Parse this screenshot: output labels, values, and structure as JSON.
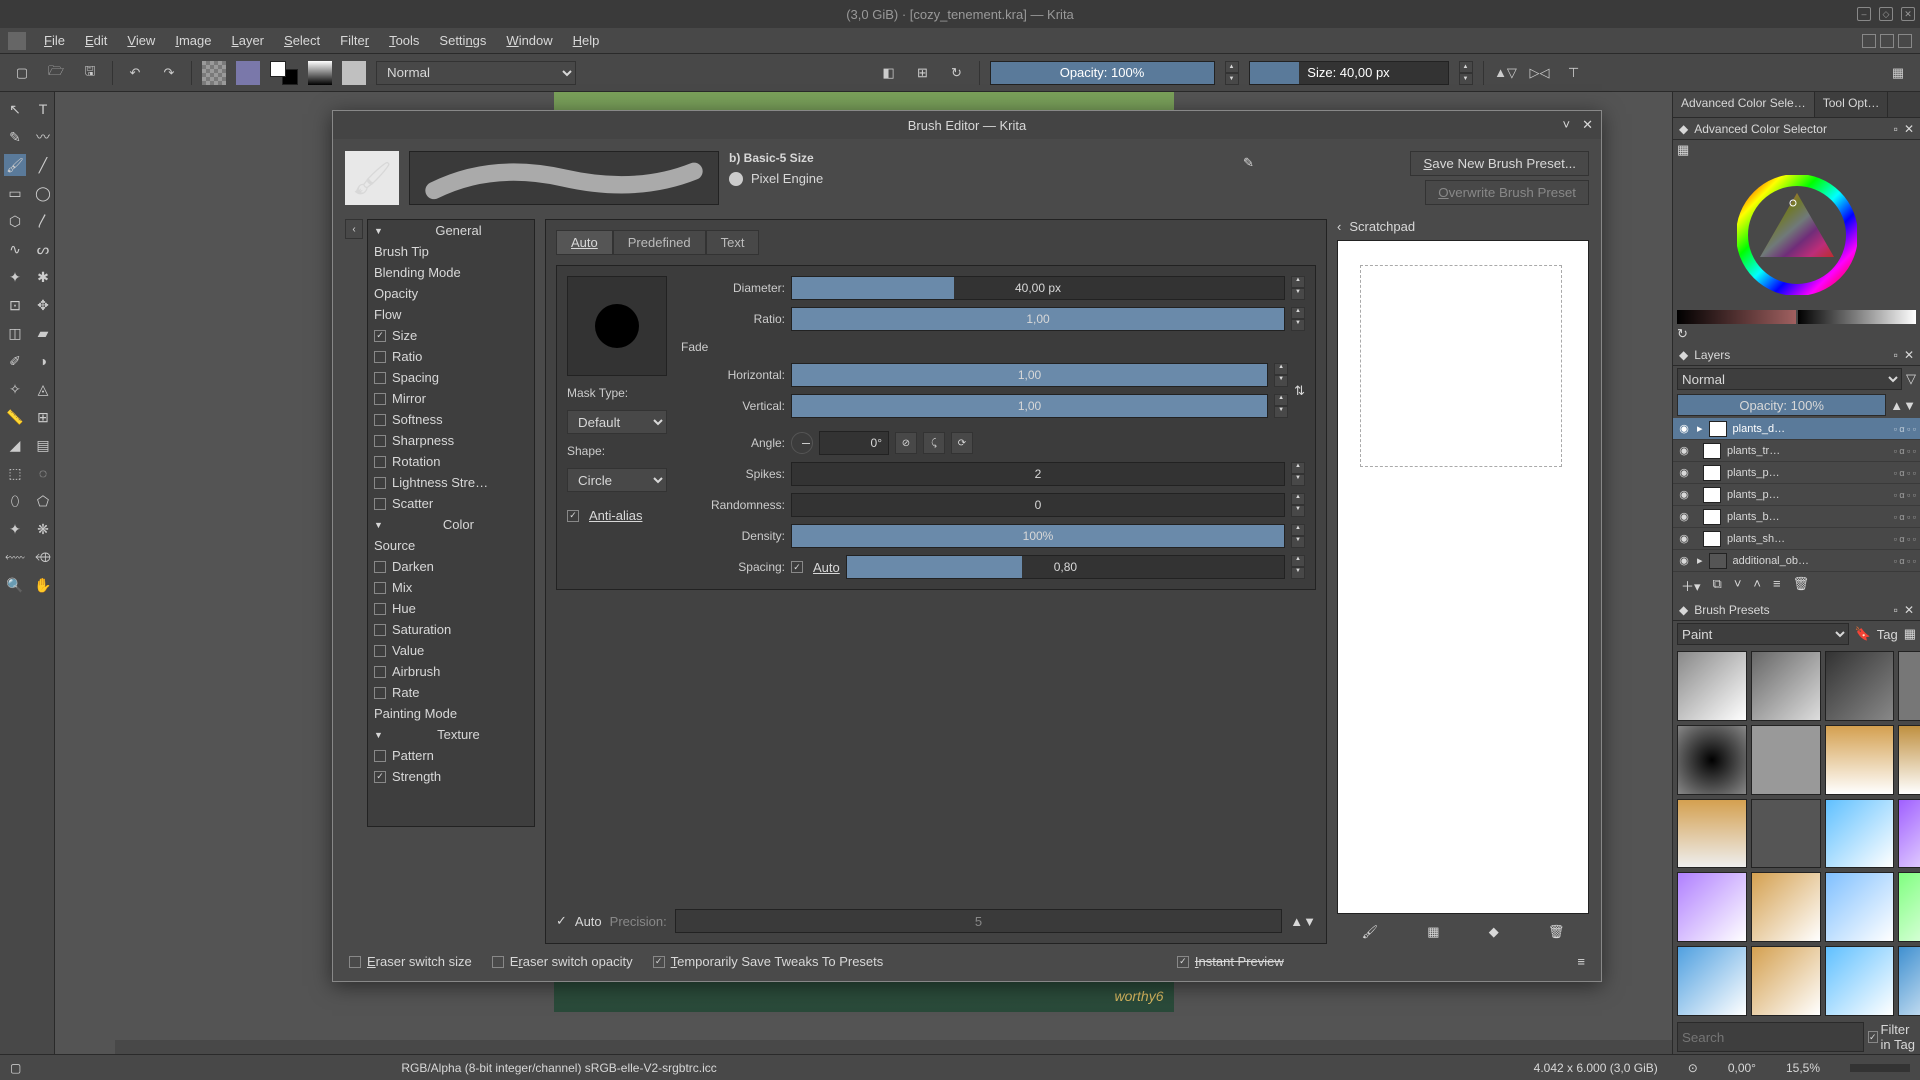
{
  "window": {
    "title": "(3,0 GiB) · [cozy_tenement.kra] — Krita"
  },
  "menubar": [
    "File",
    "Edit",
    "View",
    "Image",
    "Layer",
    "Select",
    "Filter",
    "Tools",
    "Settings",
    "Window",
    "Help"
  ],
  "toolbar": {
    "blendmode": "Normal",
    "opacity_label": "Opacity: 100%",
    "opacity_fill_pct": 100,
    "size_label": "Size: 40,00 px",
    "size_fill_pct": 25
  },
  "right_panels": {
    "tab1": "Advanced Color Sele…",
    "tab2": "Tool Opt…",
    "acs_title": "Advanced Color Selector",
    "layers_title": "Layers",
    "layers_blendmode": "Normal",
    "layers_opacity": "Opacity:  100%",
    "layers": [
      {
        "name": "plants_d…",
        "sel": true
      },
      {
        "name": "plants_tr…",
        "sel": false
      },
      {
        "name": "plants_p…",
        "sel": false
      },
      {
        "name": "plants_p…",
        "sel": false
      },
      {
        "name": "plants_b…",
        "sel": false
      },
      {
        "name": "plants_sh…",
        "sel": false
      },
      {
        "name": "additional_ob…",
        "sel": false
      }
    ],
    "presets_title": "Brush Presets",
    "presets_tag": "Paint",
    "tag_label": "Tag",
    "search_placeholder": "Search",
    "filter_in_tag": "Filter in Tag"
  },
  "statusbar": {
    "profile": "RGB/Alpha (8-bit integer/channel)  sRGB-elle-V2-srgbtrc.icc",
    "dims": "4.042 x 6.000 (3,0 GiB)",
    "rotation": "0,00°",
    "zoom": "15,5%"
  },
  "dialog": {
    "title": "Brush Editor — Krita",
    "preset_name": "b) Basic-5 Size",
    "engine": "Pixel Engine",
    "save_new": "Save New Brush Preset...",
    "overwrite": "Overwrite Brush Preset",
    "tree": {
      "groups": [
        {
          "title": "General",
          "items": [
            {
              "label": "Brush Tip",
              "cb": null
            },
            {
              "label": "Blending Mode",
              "cb": null
            },
            {
              "label": "Opacity",
              "cb": null
            },
            {
              "label": "Flow",
              "cb": null
            },
            {
              "label": "Size",
              "cb": true
            },
            {
              "label": "Ratio",
              "cb": false
            },
            {
              "label": "Spacing",
              "cb": false
            },
            {
              "label": "Mirror",
              "cb": false
            },
            {
              "label": "Softness",
              "cb": false
            },
            {
              "label": "Sharpness",
              "cb": false
            },
            {
              "label": "Rotation",
              "cb": false
            },
            {
              "label": "Lightness Stre…",
              "cb": false
            },
            {
              "label": "Scatter",
              "cb": false
            }
          ]
        },
        {
          "title": "Color",
          "items": [
            {
              "label": "Source",
              "cb": null
            },
            {
              "label": "Darken",
              "cb": false
            },
            {
              "label": "Mix",
              "cb": false
            },
            {
              "label": "Hue",
              "cb": false
            },
            {
              "label": "Saturation",
              "cb": false
            },
            {
              "label": "Value",
              "cb": false
            },
            {
              "label": "Airbrush",
              "cb": false
            },
            {
              "label": "Rate",
              "cb": false
            },
            {
              "label": "Painting Mode",
              "cb": null
            }
          ]
        },
        {
          "title": "Texture",
          "items": [
            {
              "label": "Pattern",
              "cb": false
            },
            {
              "label": "Strength",
              "cb": true
            }
          ]
        }
      ]
    },
    "tabs": [
      "Auto",
      "Predefined",
      "Text"
    ],
    "mask_type_label": "Mask Type:",
    "mask_type": "Default",
    "shape_label": "Shape:",
    "shape": "Circle",
    "anti_alias": "Anti-alias",
    "params": {
      "diameter": {
        "label": "Diameter:",
        "value": "40,00 px",
        "fill": 33
      },
      "ratio": {
        "label": "Ratio:",
        "value": "1,00",
        "fill": 100
      },
      "fade": "Fade",
      "horizontal": {
        "label": "Horizontal:",
        "value": "1,00",
        "fill": 100
      },
      "vertical": {
        "label": "Vertical:",
        "value": "1,00",
        "fill": 100
      },
      "angle": {
        "label": "Angle:",
        "value": "0°",
        "fill": 0
      },
      "spikes": {
        "label": "Spikes:",
        "value": "2",
        "fill": 0
      },
      "randomness": {
        "label": "Randomness:",
        "value": "0",
        "fill": 0
      },
      "density": {
        "label": "Density:",
        "value": "100%",
        "fill": 100
      },
      "spacing": {
        "label": "Spacing:",
        "value": "0,80",
        "fill": 33
      },
      "spacing_auto": "Auto"
    },
    "precision": {
      "auto": "Auto",
      "label": "Precision:",
      "value": "5"
    },
    "scratchpad": "Scratchpad",
    "footer": {
      "eraser_size": "Eraser switch size",
      "eraser_opacity": "Eraser switch opacity",
      "temp_save": "Temporarily Save Tweaks To Presets",
      "instant_preview": "Instant Preview"
    }
  }
}
